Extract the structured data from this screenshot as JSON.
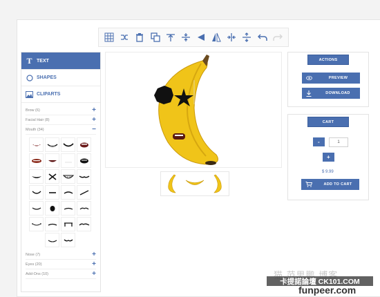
{
  "toolbar": {
    "buttons": [
      {
        "name": "grid-icon",
        "enabled": true
      },
      {
        "name": "shuffle-icon",
        "enabled": true
      },
      {
        "name": "trash-icon",
        "enabled": true
      },
      {
        "name": "copy-icon",
        "enabled": true
      },
      {
        "name": "align-top-icon",
        "enabled": true
      },
      {
        "name": "align-middle-icon",
        "enabled": true
      },
      {
        "name": "flip-horizontal-icon",
        "enabled": true
      },
      {
        "name": "flip-vertical-icon",
        "enabled": true
      },
      {
        "name": "center-horizontal-icon",
        "enabled": true
      },
      {
        "name": "center-vertical-icon",
        "enabled": true
      },
      {
        "name": "undo-icon",
        "enabled": true
      },
      {
        "name": "redo-icon",
        "enabled": false
      }
    ]
  },
  "left_panel": {
    "tabs": [
      {
        "label": "TEXT",
        "icon": "text-icon",
        "active": true
      },
      {
        "label": "SHAPES",
        "icon": "circle-icon",
        "active": false
      },
      {
        "label": "CLIPARTS",
        "icon": "image-icon",
        "active": false
      }
    ],
    "categories_top": [
      {
        "label": "Brow (6)",
        "toggle": "+"
      },
      {
        "label": "Facial Hair (8)",
        "toggle": "+"
      },
      {
        "label": "Mouth (34)",
        "toggle": "−"
      }
    ],
    "categories_bottom": [
      {
        "label": "Nose (7)",
        "toggle": "+"
      },
      {
        "label": "Eyes (20)",
        "toggle": "+"
      },
      {
        "label": "Add-Ons (10)",
        "toggle": "+"
      }
    ]
  },
  "actions_panel": {
    "title": "ACTIONS",
    "preview_label": "PREVIEW",
    "download_label": "DOWNLOAD"
  },
  "cart_panel": {
    "title": "CART",
    "minus_label": "-",
    "quantity": "1",
    "plus_label": "+",
    "price": "$ 9.99",
    "add_label": "ADD TO CART"
  },
  "watermark": {
    "text_cn": "猫 范思鹏 博客",
    "bar_text": "卡提諾論壇 CK101.COM",
    "site": "funpeer.com"
  },
  "colors": {
    "accent": "#4a6fb0",
    "banana": "#f0c419"
  }
}
